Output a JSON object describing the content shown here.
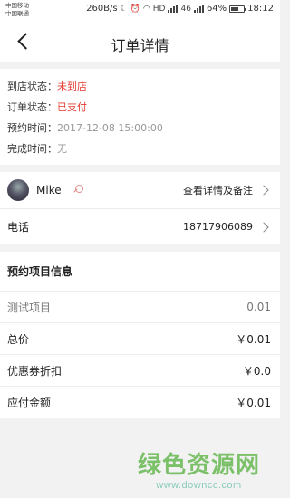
{
  "status_bar": {
    "carrier1": "中国移动",
    "carrier2": "中国联通",
    "speed": "260B/s",
    "signal": "46",
    "battery": "64%",
    "time": "18:12",
    "battery_level": 0.64
  },
  "header": {
    "title": "订单详情"
  },
  "order_info": {
    "arrival_label": "到店状态：",
    "arrival_value": "未到店",
    "order_label": "订单状态：",
    "order_value": "已支付",
    "reserve_label": "预约时间：",
    "reserve_value": "2017-12-08 15:00:00",
    "finish_label": "完成时间：",
    "finish_value": "无"
  },
  "customer": {
    "name": "Mike",
    "detail_link": "查看详情及备注",
    "phone_label": "电话",
    "phone_value": "18717906089"
  },
  "items": {
    "section_title": "预约项目信息",
    "rows": [
      {
        "label": "测试项目",
        "value": "0.01"
      },
      {
        "label": "总价",
        "value": "￥0.01"
      },
      {
        "label": "优惠券折扣",
        "value": "￥0.0"
      },
      {
        "label": "应付金额",
        "value": "￥0.01"
      }
    ]
  },
  "watermark": {
    "text": "绿色资源网",
    "url": "www.downcc.com"
  },
  "colors": {
    "accent_red": "#e5392f",
    "watermark_green": "#7cc06a"
  }
}
